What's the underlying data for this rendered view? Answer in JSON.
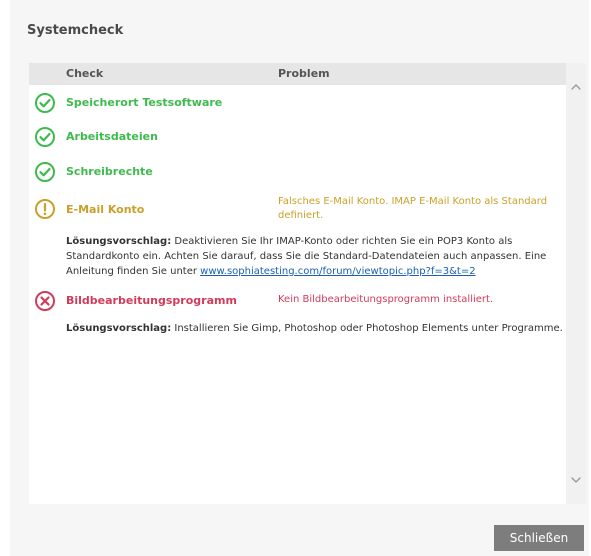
{
  "dialog": {
    "title": "Systemcheck",
    "close_label": "Schließen"
  },
  "table": {
    "headers": {
      "check": "Check",
      "problem": "Problem"
    },
    "rows": [
      {
        "status": "ok",
        "icon": "check-circle-icon",
        "check": "Speicherort Testsoftware",
        "problem": ""
      },
      {
        "status": "ok",
        "icon": "check-circle-icon",
        "check": "Arbeitsdateien",
        "problem": ""
      },
      {
        "status": "ok",
        "icon": "check-circle-icon",
        "check": "Schreibrechte",
        "problem": ""
      },
      {
        "status": "warning",
        "icon": "exclamation-circle-icon",
        "check": "E-Mail Konto",
        "problem": "Falsches E-Mail Konto. IMAP E-Mail Konto als Standard definiert.",
        "suggestion": {
          "label": "Lösungsvorschlag:",
          "text": " Deaktivieren Sie Ihr IMAP-Konto oder richten Sie ein POP3 Konto als Standardkonto ein. Achten Sie darauf, dass Sie die Standard-Datendateien auch anpassen. Eine Anleitung finden Sie unter ",
          "link": "www.sophiatesting.com/forum/viewtopic.php?f=3&t=2"
        }
      },
      {
        "status": "error",
        "icon": "x-circle-icon",
        "check": "Bildbearbeitungsprogramm",
        "problem": "Kein Bildbearbeitungsprogramm installiert.",
        "suggestion": {
          "label": "Lösungsvorschlag:",
          "text": " Installieren Sie Gimp, Photoshop oder Photoshop Elements unter Programme."
        }
      }
    ]
  },
  "colors": {
    "ok": "#3fba4f",
    "warning": "#c9a12a",
    "error": "#d13b5a",
    "button": "#7d7d7d",
    "link": "#1a5fb4"
  }
}
